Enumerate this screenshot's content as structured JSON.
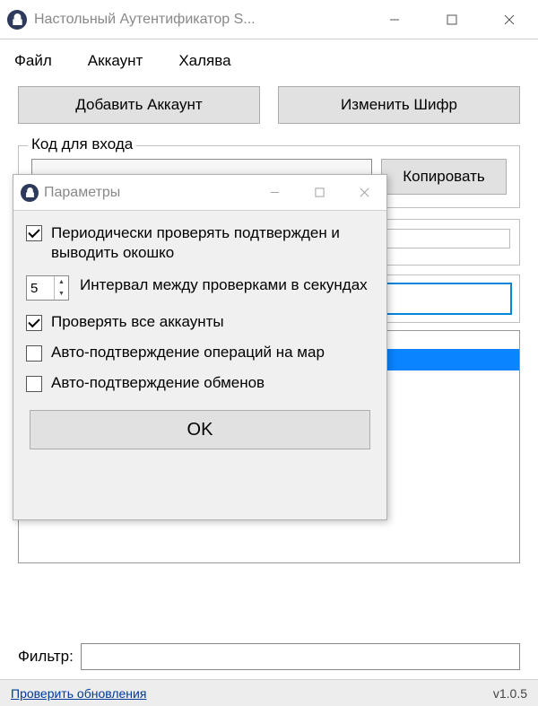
{
  "window": {
    "title": "Настольный Аутентификатор S..."
  },
  "menu": {
    "file": "Файл",
    "account": "Аккаунт",
    "freebie": "Халява"
  },
  "buttons": {
    "add_account": "Добавить Аккаунт",
    "change_cipher": "Изменить Шифр",
    "copy": "Копировать"
  },
  "code_group": {
    "legend": "Код для входа"
  },
  "filter": {
    "label": "Фильтр:",
    "value": ""
  },
  "footer": {
    "check_updates": "Проверить обновления",
    "version": "v1.0.5"
  },
  "dialog": {
    "title": "Параметры",
    "check_periodic": "Периодически проверять подтвержден и выводить окошко",
    "interval_label": "Интервал между проверками в секундах",
    "interval_value": "5",
    "check_all": "Проверять все аккаунты",
    "auto_market": "Авто-подтверждение операций на мар",
    "auto_trade": "Авто-подтверждение обменов",
    "ok": "OK",
    "checked_periodic": true,
    "checked_all": true,
    "checked_market": false,
    "checked_trade": false
  }
}
